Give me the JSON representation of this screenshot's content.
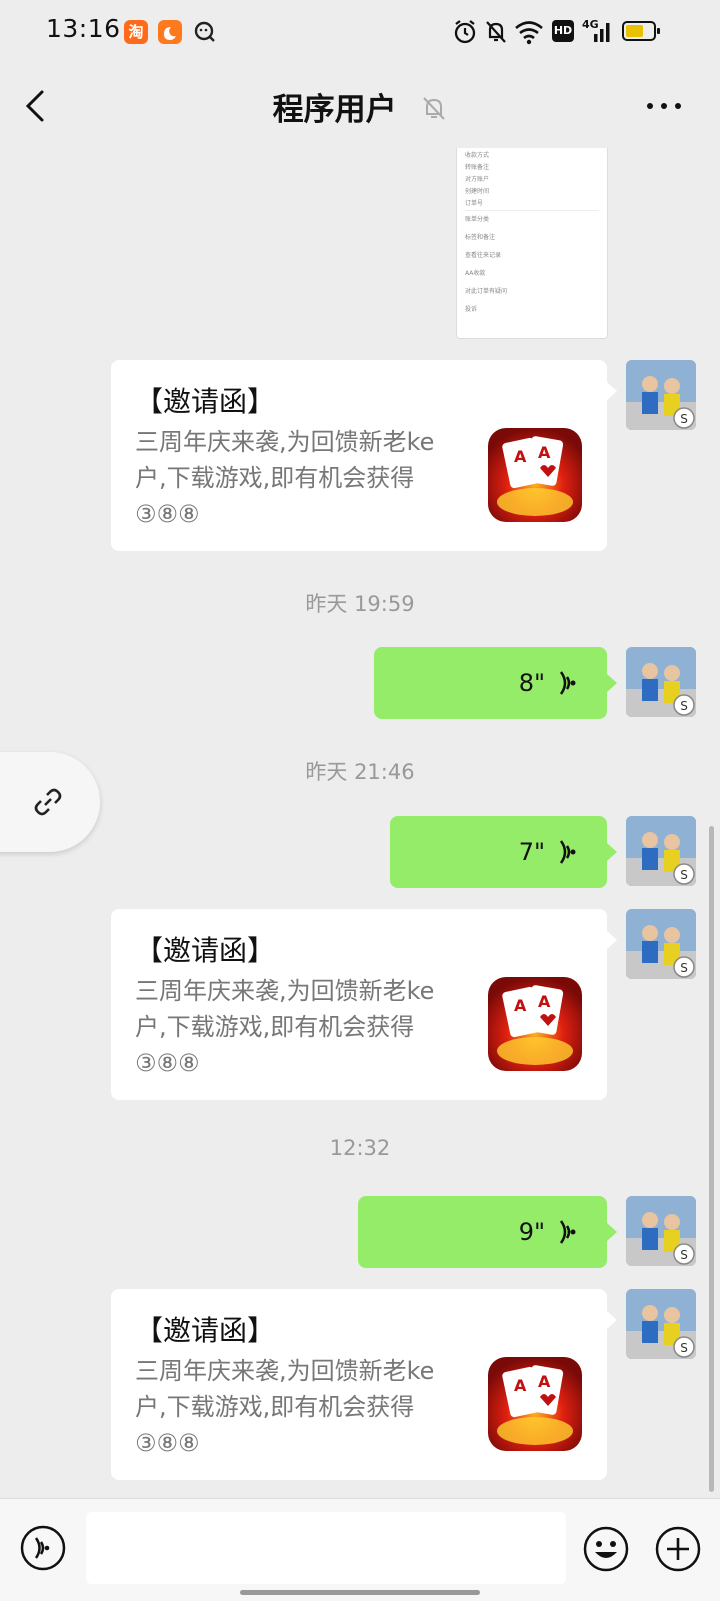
{
  "status_bar": {
    "time": "13:16",
    "app_icons": [
      "taobao-icon",
      "uc-browser-icon",
      "qq-icon"
    ],
    "indicators": [
      "alarm-icon",
      "mute-icon",
      "wifi-icon",
      "hd-icon",
      "4g-signal-icon",
      "battery-icon"
    ],
    "hd_label": "HD",
    "network_label": "4G"
  },
  "header": {
    "title": "程序用户",
    "back_icon": "chevron-left-icon",
    "mute_icon": "muted-bell-icon",
    "more_icon": "more-dots-icon"
  },
  "screenshot_preview": {
    "rows": [
      "收款方式",
      "转账备注",
      "对方账户",
      "创建时间",
      "订单号",
      "账单分类",
      "标签和备注",
      "查看往来记录",
      "AA收款",
      "对此订单有疑问",
      "投诉"
    ]
  },
  "messages": [
    {
      "type": "card",
      "title": "【邀请函】",
      "description": "三周年庆来袭,为回馈新老ke户,下载游戏,即有机会获得",
      "extra": "③⑧⑧",
      "icon": "playing-cards-game-icon"
    },
    {
      "type": "timestamp",
      "text": "昨天 19:59"
    },
    {
      "type": "voice",
      "duration": "8\"",
      "icon": "voice-wave-icon"
    },
    {
      "type": "timestamp",
      "text": "昨天 21:46"
    },
    {
      "type": "voice",
      "duration": "7\"",
      "icon": "voice-wave-icon"
    },
    {
      "type": "card",
      "title": "【邀请函】",
      "description": "三周年庆来袭,为回馈新老ke户,下载游戏,即有机会获得",
      "extra": "③⑧⑧",
      "icon": "playing-cards-game-icon"
    },
    {
      "type": "timestamp",
      "text": "12:32"
    },
    {
      "type": "voice",
      "duration": "9\"",
      "icon": "voice-wave-icon"
    },
    {
      "type": "card",
      "title": "【邀请函】",
      "description": "三周年庆来袭,为回馈新老ke户,下载游戏,即有机会获得",
      "extra": "③⑧⑧",
      "icon": "playing-cards-game-icon"
    }
  ],
  "floating_button": {
    "icon": "link-icon"
  },
  "input_bar": {
    "voice_icon": "voice-input-icon",
    "input_value": "",
    "emoji_icon": "emoji-icon",
    "plus_icon": "plus-icon"
  },
  "colors": {
    "background": "#ededed",
    "voice_bubble": "#95ec69",
    "card_bg": "#ffffff",
    "timestamp": "#999999"
  }
}
